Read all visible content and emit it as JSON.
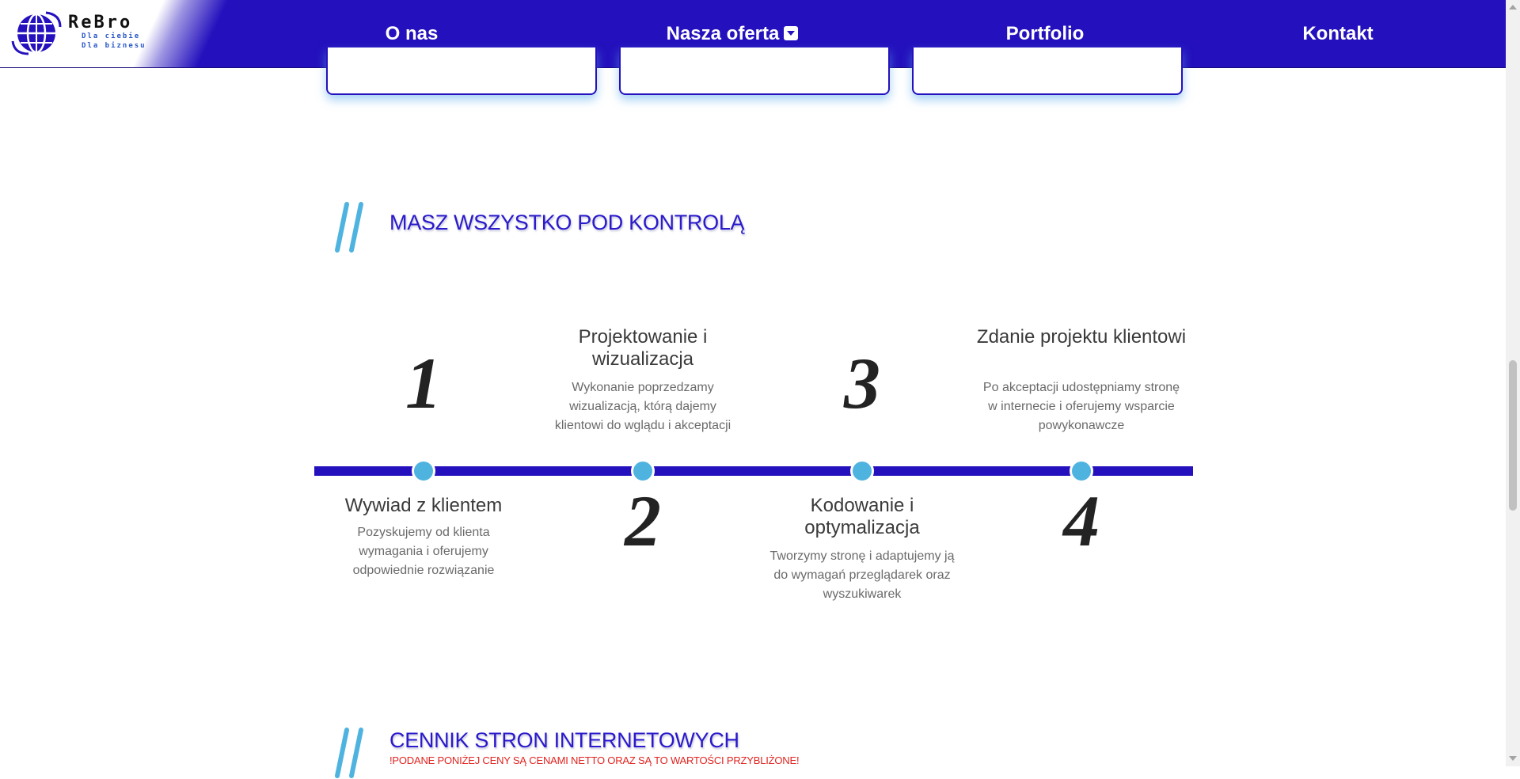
{
  "brand": {
    "name": "ReBro",
    "tagline_1": "Dla ciebie",
    "tagline_2": "Dla biznesu",
    "colors": {
      "primary": "#2411bd",
      "accent": "#4fb3e0",
      "notice": "#e0231f"
    }
  },
  "nav": {
    "items": [
      {
        "label": "O nas"
      },
      {
        "label": "Nasza oferta",
        "icon": "caret-down-icon"
      },
      {
        "label": "Portfolio"
      },
      {
        "label": "Kontakt"
      }
    ]
  },
  "process_section": {
    "title": "MASZ WSZYSTKO POD KONTROLĄ",
    "steps": [
      {
        "number": "1",
        "title": "Wywiad z klientem",
        "description": "Pozyskujemy od klienta wymagania i oferujemy odpowiednie rozwiązanie"
      },
      {
        "number": "2",
        "title": "Projektowanie i wizualizacja",
        "description": "Wykonanie poprzedzamy wizualizacją, którą dajemy klientowi do wglądu i akceptacji"
      },
      {
        "number": "3",
        "title": "Kodowanie i optymalizacja",
        "description": "Tworzymy stronę i adaptujemy ją do wymagań przeglądarek oraz wyszukiwarek"
      },
      {
        "number": "4",
        "title": "Zdanie projektu klientowi",
        "description": "Po akceptacji udostępniamy stronę w internecie i oferujemy wsparcie powykonawcze"
      }
    ]
  },
  "pricing_section": {
    "title": "CENNIK STRON INTERNETOWYCH",
    "notice": "!PODANE PONIŻEJ CENY SĄ CENAMI NETTO ORAZ SĄ TO WARTOŚCI PRZYBLIŻONE!"
  }
}
